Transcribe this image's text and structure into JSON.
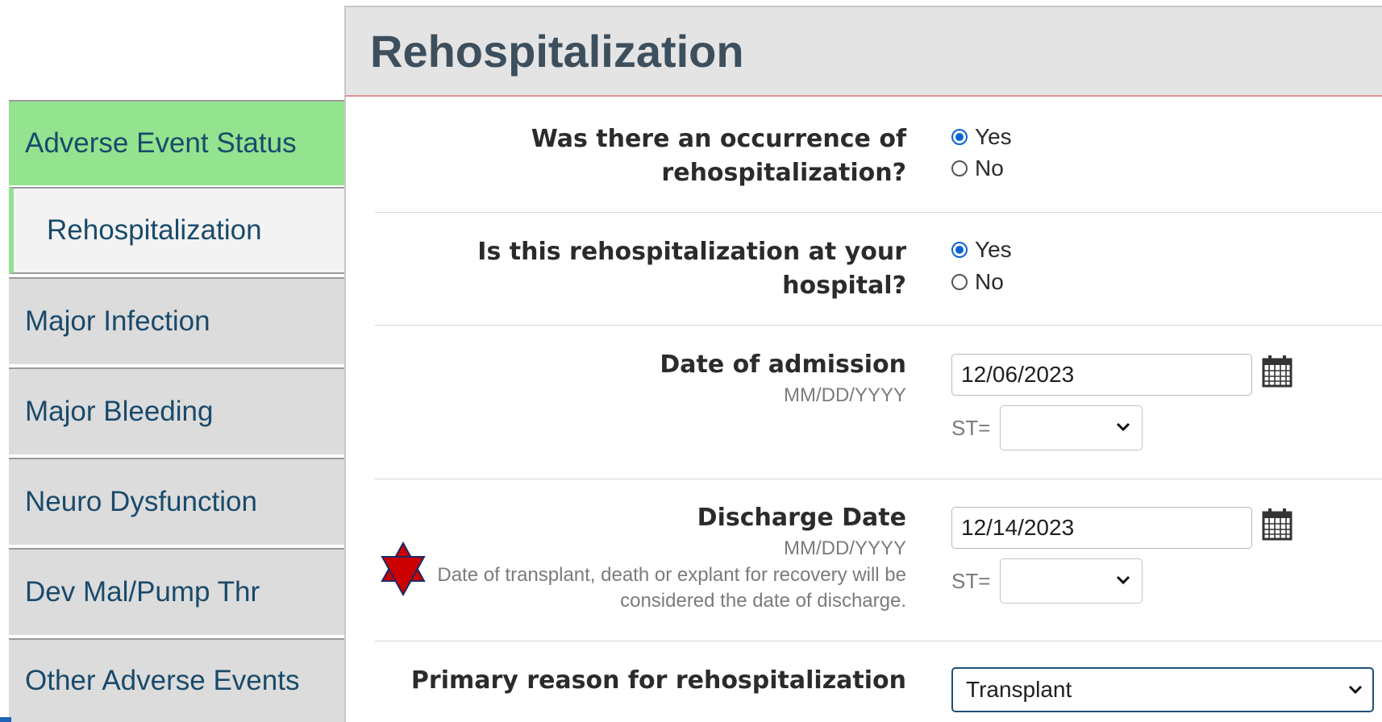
{
  "sidebar": {
    "items": [
      {
        "label": "Adverse Event Status"
      },
      {
        "label": "Rehospitalization"
      },
      {
        "label": "Major Infection"
      },
      {
        "label": "Major Bleeding"
      },
      {
        "label": "Neuro Dysfunction"
      },
      {
        "label": "Dev Mal/Pump Thr"
      },
      {
        "label": "Other Adverse Events"
      }
    ]
  },
  "header": {
    "title": "Rehospitalization"
  },
  "questions": {
    "occurrence": {
      "label_line1": "Was there an occurrence of",
      "label_line2": "rehospitalization?",
      "options": [
        "Yes",
        "No"
      ],
      "selected": "Yes"
    },
    "at_hospital": {
      "label_line1": "Is this rehospitalization at your",
      "label_line2": "hospital?",
      "options": [
        "Yes",
        "No"
      ],
      "selected": "Yes"
    },
    "admission": {
      "label": "Date of admission",
      "format": "MM/DD/YYYY",
      "value": "12/06/2023",
      "st_label": "ST=",
      "st_value": ""
    },
    "discharge": {
      "label": "Discharge Date",
      "format": "MM/DD/YYYY",
      "note_line1": "Date of transplant, death or explant for recovery will be",
      "note_line2": "considered the date of discharge.",
      "value": "12/14/2023",
      "st_label": "ST=",
      "st_value": ""
    },
    "reason": {
      "label": "Primary reason for rehospitalization",
      "value": "Transplant"
    }
  },
  "colors": {
    "sidebar_complete": "#93e38f",
    "sidebar_default": "#dcdcdc",
    "nav_text": "#1a4a6b",
    "title_text": "#3d4f5d",
    "header_underline": "#e38f95",
    "radio_selected": "#0b63d8",
    "star": "#cc0000"
  },
  "icons": [
    "calendar-icon",
    "chevron-down-icon",
    "star-of-david-flag-icon"
  ]
}
